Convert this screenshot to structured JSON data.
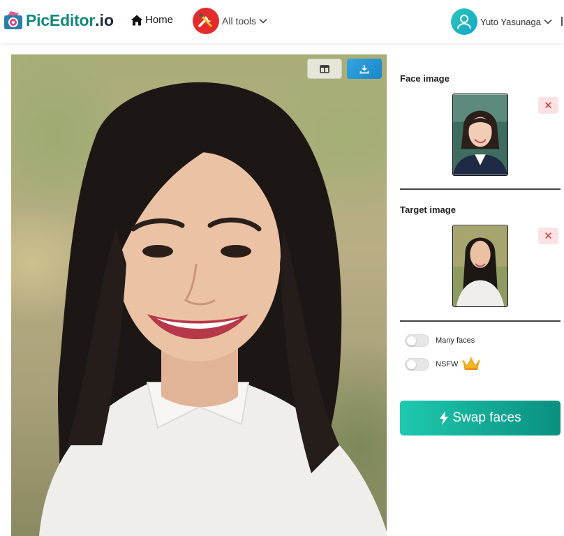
{
  "header": {
    "logo_text": "PicEditor",
    "logo_ext": ".io",
    "home_label": "Home",
    "tools_label": "All tools",
    "user_name": "Yuto Yasunaga",
    "brand_color": "#12877d",
    "icons": [
      "camera-logo-icon",
      "home-icon",
      "tools-icon",
      "chevron-down-icon",
      "user-avatar-icon"
    ]
  },
  "main_image": {
    "actions": [
      {
        "name": "compare-view",
        "icon": "split-view-icon"
      },
      {
        "name": "download",
        "icon": "download-icon"
      }
    ]
  },
  "panel": {
    "face_title": "Face image",
    "target_title": "Target image",
    "remove_symbol": "✕",
    "toggles": [
      {
        "label": "Many faces",
        "on": false
      },
      {
        "label": "NSFW",
        "on": false,
        "icon": "crown-icon"
      }
    ],
    "swap_label": "Swap faces",
    "swap_icon": "lightning-icon",
    "accent_color": "#1ec9ae",
    "remove_color": "#e3342f"
  }
}
